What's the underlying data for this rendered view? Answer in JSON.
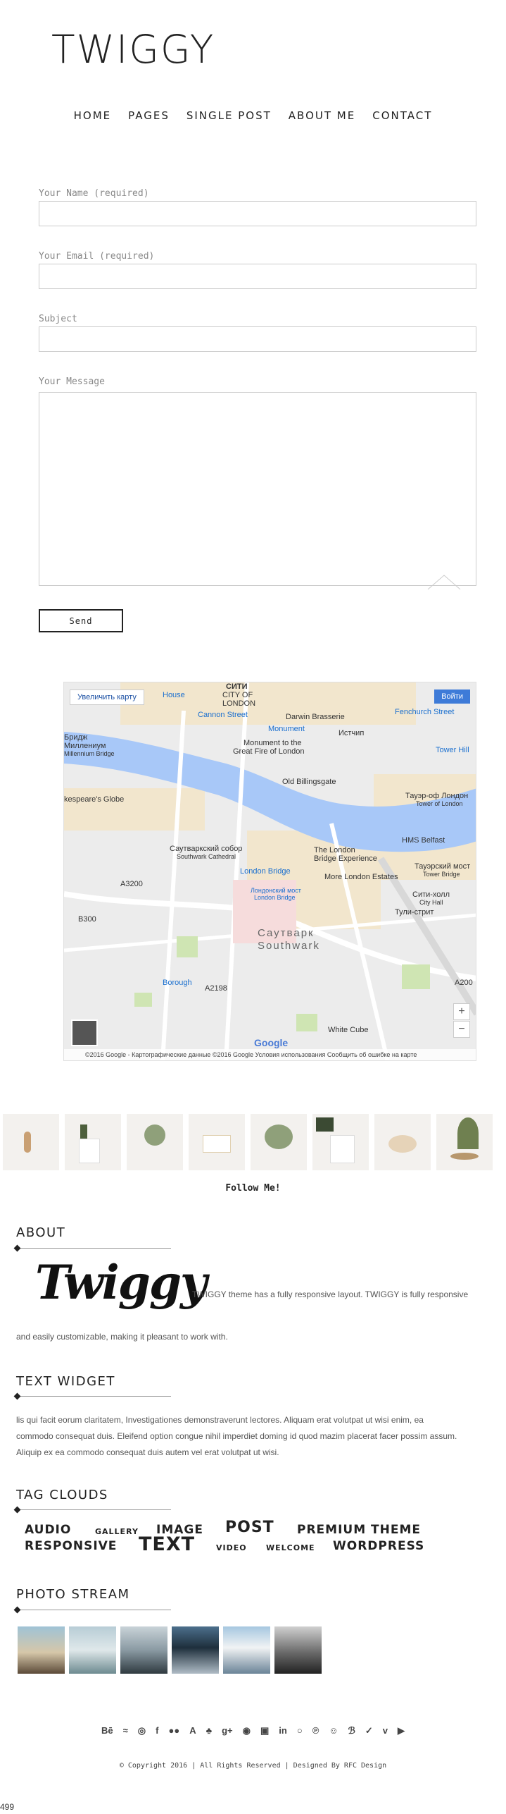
{
  "site": {
    "title": "TWIGGY"
  },
  "nav": [
    "HOME",
    "PAGES",
    "SINGLE POST",
    "ABOUT ME",
    "CONTACT"
  ],
  "form": {
    "name_label": "Your Name (required)",
    "email_label": "Your Email (required)",
    "subject_label": "Subject",
    "message_label": "Your Message",
    "send_label": "Send"
  },
  "map": {
    "enlarge": "Увеличить карту",
    "signin": "Войти",
    "labels": [
      "СИТИ",
      "CITY OF",
      "LONDON",
      "Cannon Street",
      "Monument",
      "Darwin Brasserie",
      "Fenchurch Street",
      "Истчип",
      "Monument to the",
      "Great Fire of London",
      "Tower Hill",
      "Бридж",
      "Миллениум",
      "Millennium Bridge",
      "Old Billingsgate",
      "Тауэр-оф Лондон",
      "Tower of London",
      "kespeare's Globe",
      "HMS Belfast",
      "Саутваркский собор",
      "Southwark Cathedral",
      "The London",
      "Bridge Experience",
      "Тауэрский мост",
      "Tower Bridge",
      "London Bridge",
      "Лондонский мост",
      "London Bridge",
      "More London Estates",
      "Сити-холл",
      "City Hall",
      "A3200",
      "B300",
      "Саутварк",
      "Southwark",
      "Borough",
      "A2198",
      "White Cube",
      "Тули-стрит",
      "House",
      "A200"
    ],
    "footer": "©2016 Google - Картографические данные ©2016 Google   Условия использования   Сообщить об ошибке на карте",
    "zoom_in": "+",
    "zoom_out": "−",
    "google": "Google"
  },
  "follow": "Follow Me!",
  "about": {
    "title": "ABOUT",
    "logo_text": "Twiggy",
    "text1": "TWIGGY theme has a fully responsive layout. TWIGGY is fully responsive",
    "text2": "and easily customizable, making it pleasant to work with."
  },
  "text_widget": {
    "title": "TEXT WIDGET",
    "lines": [
      "lis qui facit eorum claritatem, Investigationes demonstraverunt lectores. Aliquam erat volutpat ut wisi enim, ea",
      "commodo consequat duis. Eleifend option congue nihil imperdiet doming id quod mazim placerat facer possim assum.",
      "Aliquip ex ea commodo consequat duis autem vel erat volutpat ut wisi."
    ]
  },
  "tag_clouds": {
    "title": "TAG CLOUDS",
    "tags": [
      "AUDIO",
      "GALLERY",
      "IMAGE",
      "POST",
      "PREMIUM THEME",
      "RESPONSIVE",
      "TEXT",
      "VIDEO",
      "WELCOME",
      "WORDPRESS"
    ]
  },
  "photo_stream": {
    "title": "PHOTO STREAM"
  },
  "social": [
    "Bē",
    "≈",
    "◎",
    "f",
    "●●",
    "A",
    "♣",
    "g+",
    "◉",
    "▣",
    "in",
    "○",
    "℗",
    "☺",
    "ℬ",
    "✓",
    "v",
    "▶"
  ],
  "copyright": "© Copyright 2016 | All Rights Reserved | Designed By RFC Design",
  "corner_text": "499"
}
